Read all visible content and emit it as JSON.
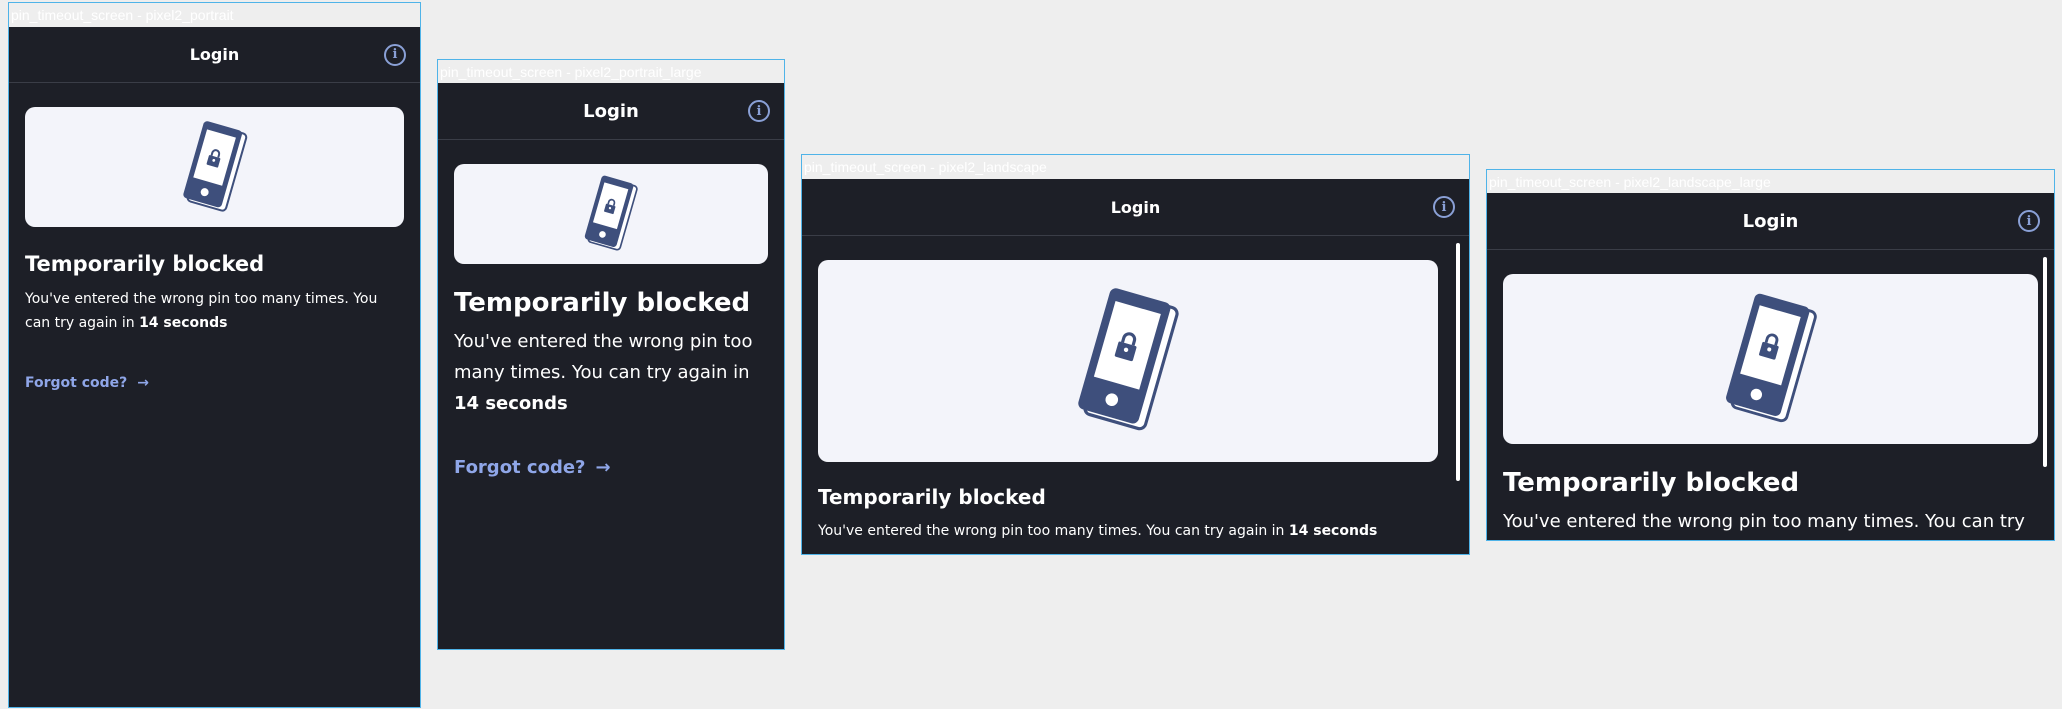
{
  "frames": [
    {
      "label": "pin_timeout_screen - pixel2_portrait"
    },
    {
      "label": "pin_timeout_screen - pixel2_portrait_large"
    },
    {
      "label": "pin_timeout_screen - pixel2_landscape"
    },
    {
      "label": "pin_timeout_screen - pixel2_landscape_large"
    }
  ],
  "appbar": {
    "title": "Login",
    "info_icon": "info-icon"
  },
  "illustration": {
    "icon": "locked-phone-icon"
  },
  "message": {
    "title": "Temporarily blocked",
    "body_prefix": "You've entered the wrong pin too many times. You can try again in ",
    "countdown": "14 seconds"
  },
  "forgot": {
    "label": "Forgot code?",
    "icon": "arrow-right-icon"
  },
  "colors": {
    "background": "#1d1f27",
    "card": "#f3f4fa",
    "accent": "#8fa6e8",
    "frame_border": "#4fb3e8"
  }
}
